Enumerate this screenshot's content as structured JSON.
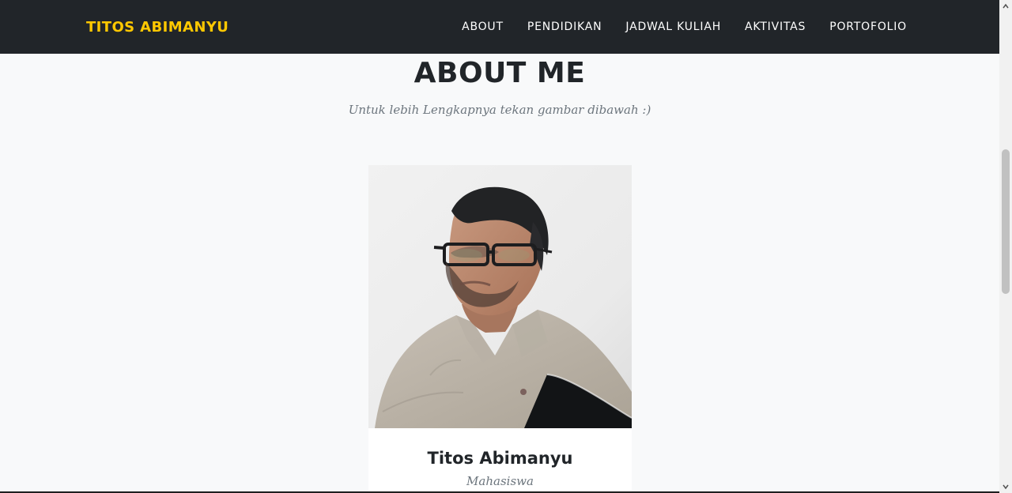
{
  "navbar": {
    "brand": "TITOS ABIMANYU",
    "links": [
      "ABOUT",
      "PENDIDIKAN",
      "JADWAL KULIAH",
      "AKTIVITAS",
      "PORTOFOLIO"
    ]
  },
  "about": {
    "title": "ABOUT ME",
    "subtitle": "Untuk lebih Lengkapnya tekan gambar dibawah :)",
    "card": {
      "name": "Titos Abimanyu",
      "role": "Mahasiswa"
    }
  },
  "colors": {
    "navbar_bg": "#212529",
    "brand": "#ffc800",
    "page_bg": "#f8f9fa",
    "muted_text": "#6c757d",
    "heading_text": "#212529"
  },
  "icons": {
    "scroll_up": "chevron-up-icon",
    "scroll_down": "chevron-down-icon"
  }
}
